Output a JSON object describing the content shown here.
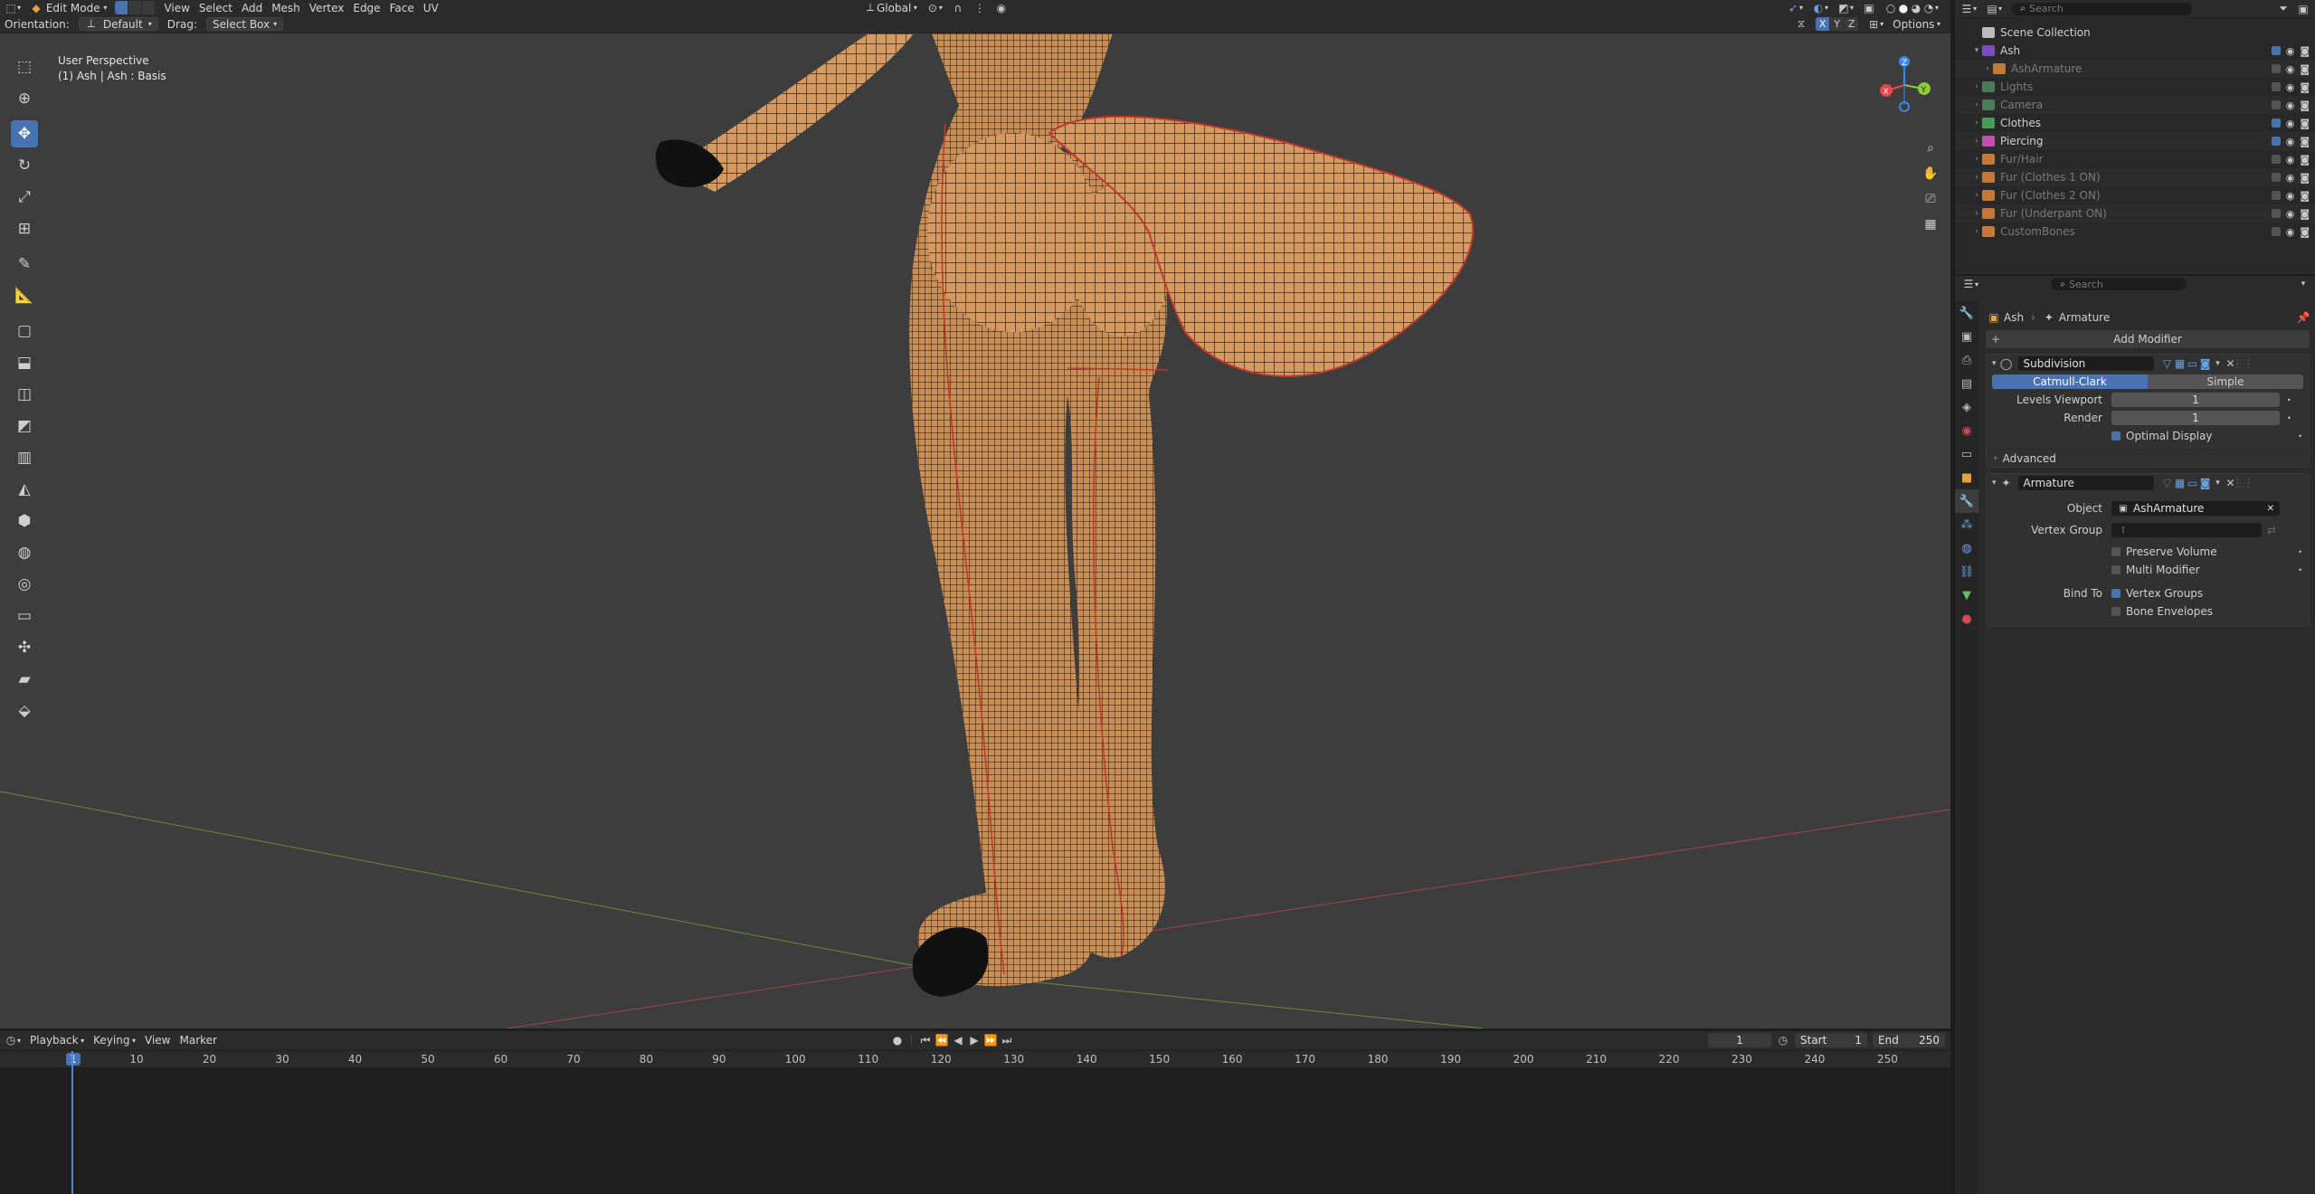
{
  "header": {
    "editor_icon": "cube-icon",
    "mode": "Edit Mode",
    "menus": [
      "View",
      "Select",
      "Add",
      "Mesh",
      "Vertex",
      "Edge",
      "Face",
      "UV"
    ],
    "transform_orientation": "Global",
    "search_placeholder": "Search"
  },
  "subheader": {
    "orientation_label": "Orientation:",
    "orientation_value": "Default",
    "drag_label": "Drag:",
    "drag_value": "Select Box",
    "axes": [
      "X",
      "Y",
      "Z"
    ],
    "options_label": "Options"
  },
  "viewport": {
    "perspective": "User Perspective",
    "object_info": "(1) Ash | Ash : Basis",
    "gizmo_axes": [
      "X",
      "Y",
      "Z"
    ],
    "colors": {
      "x": "#e8484b",
      "y": "#8ccc3a",
      "z": "#3b87e8"
    }
  },
  "outliner": {
    "title": "Scene Collection",
    "search_placeholder": "Search",
    "items": [
      {
        "label": "Ash",
        "level": 1,
        "expanded": true,
        "color": "#7b4fc3",
        "dim": false
      },
      {
        "label": "AshArmature",
        "level": 2,
        "expanded": false,
        "color": "#c47a3a",
        "dim": true
      },
      {
        "label": "Lights",
        "level": 1,
        "expanded": false,
        "color": "#4a7c59",
        "dim": true
      },
      {
        "label": "Camera",
        "level": 1,
        "expanded": false,
        "color": "#4a7c59",
        "dim": true
      },
      {
        "label": "Clothes",
        "level": 1,
        "expanded": false,
        "color": "#4a9a59",
        "dim": false
      },
      {
        "label": "Piercing",
        "level": 1,
        "expanded": false,
        "color": "#c24fb0",
        "dim": false
      },
      {
        "label": "Fur/Hair",
        "level": 1,
        "expanded": false,
        "color": "#c4793a",
        "dim": true
      },
      {
        "label": "Fur (Clothes 1 ON)",
        "level": 1,
        "expanded": false,
        "color": "#c4793a",
        "dim": true
      },
      {
        "label": "Fur (Clothes 2 ON)",
        "level": 1,
        "expanded": false,
        "color": "#c4793a",
        "dim": true
      },
      {
        "label": "Fur (Underpant ON)",
        "level": 1,
        "expanded": false,
        "color": "#c4793a",
        "dim": true
      },
      {
        "label": "CustomBones",
        "level": 1,
        "expanded": false,
        "color": "#c4793a",
        "dim": true
      }
    ]
  },
  "properties": {
    "search_placeholder": "Search",
    "breadcrumb": [
      "Ash",
      "Armature"
    ],
    "add_modifier": "Add Modifier",
    "subdivision": {
      "name": "Subdivision",
      "tabs": [
        "Catmull-Clark",
        "Simple"
      ],
      "levels_viewport_label": "Levels Viewport",
      "levels_viewport": "1",
      "render_label": "Render",
      "render": "1",
      "optimal_display": "Optimal Display",
      "advanced": "Advanced"
    },
    "armature": {
      "name": "Armature",
      "object_label": "Object",
      "object_value": "AshArmature",
      "vertex_group_label": "Vertex Group",
      "preserve_volume": "Preserve Volume",
      "multi_modifier": "Multi Modifier",
      "bind_to_label": "Bind To",
      "vertex_groups": "Vertex Groups",
      "bone_envelopes": "Bone Envelopes"
    }
  },
  "timeline": {
    "menus": [
      "Playback",
      "Keying",
      "View",
      "Marker"
    ],
    "current_frame": "1",
    "start_label": "Start",
    "start": "1",
    "end_label": "End",
    "end": "250",
    "ruler": [
      "1",
      "10",
      "20",
      "30",
      "40",
      "50",
      "60",
      "70",
      "80",
      "90",
      "100",
      "110",
      "120",
      "130",
      "140",
      "150",
      "160",
      "170",
      "180",
      "190",
      "200",
      "210",
      "220",
      "230",
      "240",
      "250"
    ]
  }
}
